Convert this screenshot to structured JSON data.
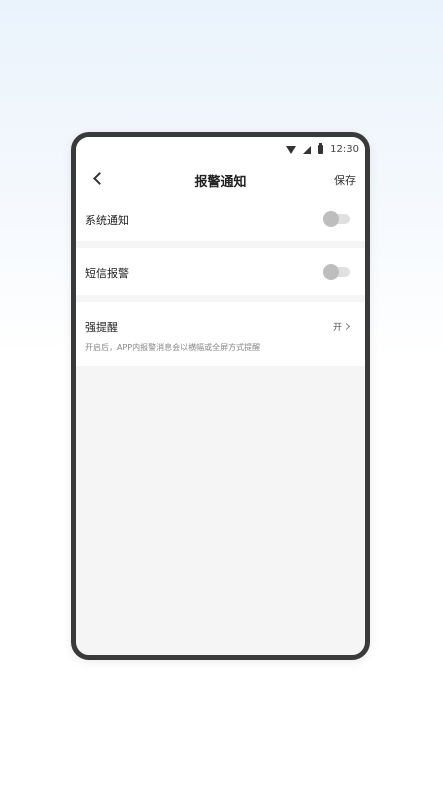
{
  "status_bar": {
    "time": "12:30",
    "icons": [
      "wifi-icon",
      "signal-icon",
      "battery-icon"
    ]
  },
  "nav": {
    "back_icon": "chevron-left-icon",
    "title": "报警通知",
    "save_label": "保存"
  },
  "settings": {
    "system_notify": {
      "label": "系统通知",
      "enabled": false
    },
    "sms_alarm": {
      "label": "短信报警",
      "enabled": false
    },
    "strong_remind": {
      "label": "强提醒",
      "value": "开",
      "description": "开启后，APP内报警消息会以横幅或全屏方式提醒"
    }
  },
  "colors": {
    "frame": "#3a3a3a",
    "page_bg": "#f5f5f5",
    "toggle_off_track": "#e0e0e0",
    "toggle_off_knob": "#bdbdbd"
  }
}
